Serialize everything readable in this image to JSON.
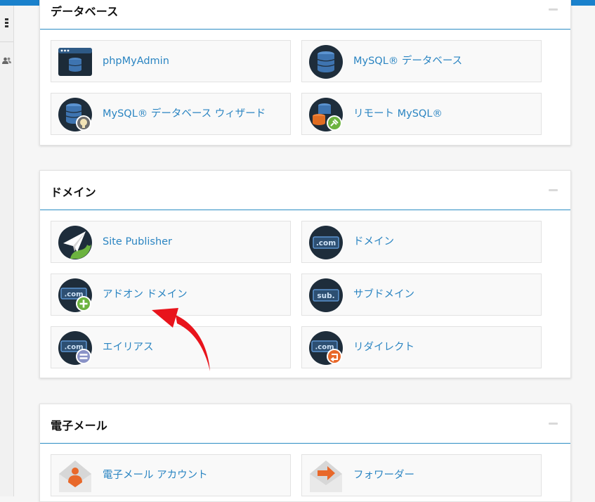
{
  "colors": {
    "accent": "#1a81cc",
    "link": "#2b85c2",
    "title": "#111111",
    "arrow": "#e8141c"
  },
  "rail": {
    "icons": [
      "menu-dots-icon",
      "users-icon"
    ]
  },
  "sections": [
    {
      "title": "データベース",
      "items": [
        {
          "label": "phpMyAdmin",
          "icon": "phpmyadmin-icon"
        },
        {
          "label": "MySQL® データベース",
          "icon": "database-icon"
        },
        {
          "label": "MySQL® データベース ウィザード",
          "icon": "database-wizard-icon"
        },
        {
          "label": "リモート MySQL®",
          "icon": "remote-mysql-icon"
        }
      ]
    },
    {
      "title": "ドメイン",
      "items": [
        {
          "label": "Site Publisher",
          "icon": "site-publisher-icon"
        },
        {
          "label": "ドメイン",
          "icon": "domains-icon",
          "badge": ".com"
        },
        {
          "label": "アドオン ドメイン",
          "icon": "addon-domain-icon",
          "badge": ".com"
        },
        {
          "label": "サブドメイン",
          "icon": "subdomain-icon",
          "badge": "sub."
        },
        {
          "label": "エイリアス",
          "icon": "alias-icon",
          "badge": ".com"
        },
        {
          "label": "リダイレクト",
          "icon": "redirect-icon",
          "badge": ".com"
        }
      ]
    },
    {
      "title": "電子メール",
      "items": [
        {
          "label": "電子メール アカウント",
          "icon": "email-account-icon"
        },
        {
          "label": "フォワーダー",
          "icon": "forwarder-icon"
        }
      ]
    }
  ]
}
